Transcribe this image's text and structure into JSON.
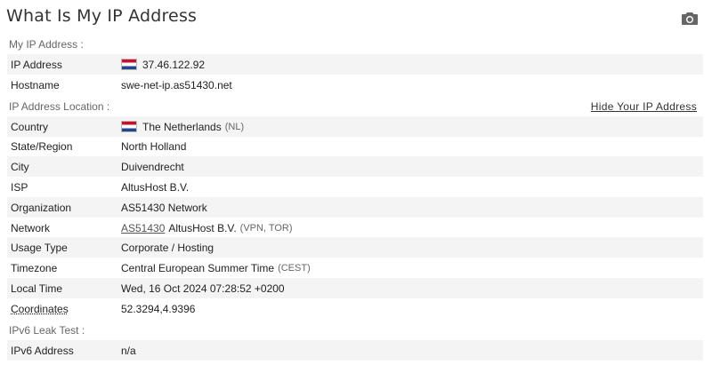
{
  "page": {
    "title": "What Is My IP Address",
    "camera_icon": "camera-icon"
  },
  "my_ip": {
    "section_label": "My IP Address :",
    "ip_label": "IP Address",
    "ip_value": "37.46.122.92",
    "ip_flag": "netherlands-flag",
    "hostname_label": "Hostname",
    "hostname_value": "swe-net-ip.as51430.net"
  },
  "location": {
    "section_label": "IP Address Location :",
    "hide_link": "Hide Your IP Address",
    "country_label": "Country",
    "country_value": "The Netherlands",
    "country_code": "(NL)",
    "country_flag": "netherlands-flag",
    "state_label": "State/Region",
    "state_value": "North Holland",
    "city_label": "City",
    "city_value": "Duivendrecht",
    "isp_label": "ISP",
    "isp_value": "AltusHost B.V.",
    "org_label": "Organization",
    "org_value": "AS51430 Network",
    "network_label": "Network",
    "network_as": "AS51430",
    "network_name": "AltusHost B.V.",
    "network_tags": "(VPN, TOR)",
    "usage_label": "Usage Type",
    "usage_value": "Corporate / Hosting",
    "timezone_label": "Timezone",
    "timezone_value": "Central European Summer Time",
    "timezone_abbr": "(CEST)",
    "localtime_label": "Local Time",
    "localtime_value": "Wed, 16 Oct 2024 07:28:52 +0200",
    "coords_label": "Coordinates",
    "coords_value": "52.3294,4.9396"
  },
  "ipv6": {
    "section_label": "IPv6 Leak Test :",
    "address_label": "IPv6 Address",
    "address_value": "n/a"
  },
  "colors": {
    "flag_red": "#c8102e",
    "flag_white": "#ffffff",
    "flag_blue": "#21468b",
    "row_alt": "#f4f4f4"
  }
}
